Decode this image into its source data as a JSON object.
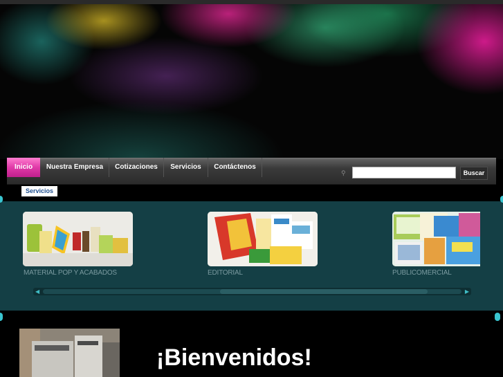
{
  "nav": {
    "items": [
      {
        "label": "Inicio",
        "active": true
      },
      {
        "label": "Nuestra Empresa",
        "active": false
      },
      {
        "label": "Cotizaciones",
        "active": false
      },
      {
        "label": "Servicios",
        "active": false
      },
      {
        "label": "Contáctenos",
        "active": false
      }
    ]
  },
  "search": {
    "placeholder": "",
    "value": "",
    "button_label": "Buscar"
  },
  "section_tab": {
    "label": "Servicios"
  },
  "carousel": {
    "items": [
      {
        "caption": "MATERIAL POP Y ACABADOS"
      },
      {
        "caption": "EDITORIAL"
      },
      {
        "caption": "PUBLICOMERCIAL"
      }
    ]
  },
  "welcome": {
    "heading": "¡Bienvenidos!"
  },
  "colors": {
    "accent": "#e03aa8",
    "panel": "#143f45",
    "highlight": "#39c5d0"
  }
}
